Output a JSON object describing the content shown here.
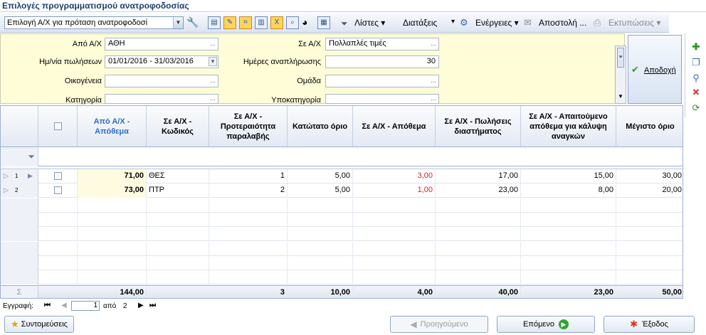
{
  "window": {
    "title": "Επιλογές προγραμματισμού ανατροφοδοσίας"
  },
  "toolbar": {
    "mode_value": "Επιλογή Α/Χ για πρόταση  ανατροφοδοσί",
    "lists_label": "Λίστες",
    "sorts_label": "Διατάξεις",
    "actions_label": "Ενέργειες",
    "send_label": "Αποστολή ...",
    "prints_label": "Εκτυπώσεις"
  },
  "filter": {
    "from_wh_label": "Από Α/Χ",
    "from_wh_value": "ΑΘΗ",
    "to_wh_label": "Σε Α/Χ",
    "to_wh_value": "Πολλαπλές τιμές",
    "dates_label": "Ημ/νία πωλήσεων",
    "dates_value": "01/01/2016 - 31/03/2016",
    "days_label": "Ημέρες αναπλήρωσης",
    "days_value": "30",
    "family_label": "Οικογένεια",
    "group_label": "Ομάδα",
    "category_label": "Κατηγορία",
    "subcategory_label": "Υποκατηγορία",
    "accept_label": "Αποδοχή"
  },
  "grid": {
    "columns": [
      "Από Α/Χ - Απόθεμα",
      "Σε Α/Χ - Κωδικός",
      "Σε Α/Χ - Προτεραιότητα παραλαβής",
      "Κατώτατο όριο",
      "Σε Α/Χ - Απόθεμα",
      "Σε Α/Χ - Πωλήσεις διαστήματος",
      "Σε Α/Χ - Απαιτούμενο απόθεμα για κάλυψη αναγκών",
      "Μέγιστο όριο"
    ],
    "rows": [
      {
        "num": "1",
        "from_stock": "71,00",
        "code": "ΘΕΣ",
        "priority": "1",
        "min": "5,00",
        "stock": "3,00",
        "sales": "17,00",
        "required": "15,00",
        "max": "30,00"
      },
      {
        "num": "2",
        "from_stock": "73,00",
        "code": "ΠΤΡ",
        "priority": "2",
        "min": "5,00",
        "stock": "1,00",
        "sales": "23,00",
        "required": "8,00",
        "max": "20,00"
      }
    ],
    "totals": {
      "from_stock": "144,00",
      "priority": "3",
      "min": "10,00",
      "stock": "4,00",
      "sales": "40,00",
      "required": "23,00",
      "max": "50,00"
    },
    "sigma": "Σ"
  },
  "status": {
    "record_label": "Εγγραφή:",
    "current": "1",
    "of_label": "από",
    "total": "2"
  },
  "footer": {
    "shortcuts_label": "Συντομεύσεις",
    "prev_label": "Προηγούμενο",
    "next_label": "Επόμενο",
    "exit_label": "Έξοδος"
  },
  "colors": {
    "highlight_cell": "#fffbe0",
    "negative_red": "#e02020",
    "filter_bg": "#fffdd8"
  }
}
